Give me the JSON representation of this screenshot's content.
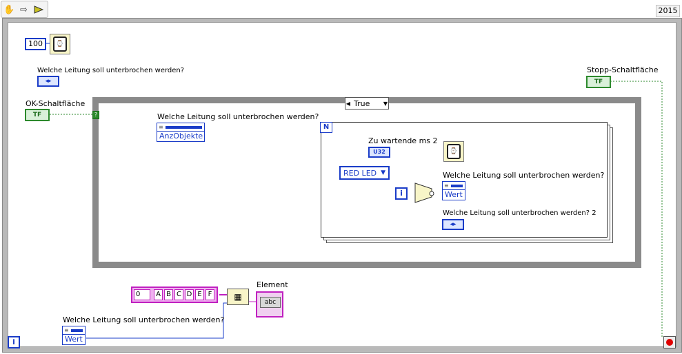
{
  "toolbar": {
    "run_mode_icon": "hand-icon",
    "arrow_icon": "arrow-right-icon",
    "run_icon": "run-arrow-icon"
  },
  "version": "2015",
  "block": {
    "wait_const": "100",
    "label_top_enum": "Welche Leitung soll unterbrochen werden?",
    "label_ok": "OK-Schaltfläche",
    "ok_term": "TF",
    "label_stop": "Stopp-Schaltfläche",
    "stop_term": "TF",
    "case_selector": "True",
    "prop_node_label": "Welche Leitung soll unterbrochen werden?",
    "prop_node_prop": "AnzObjekte",
    "n_term": "N",
    "label_wait_ms": "Zu wartende ms 2",
    "u32": "U32",
    "enum_const": "RED LED",
    "i_term": "i",
    "prop_node2_label": "Welche Leitung soll unterbrochen werden?",
    "prop_node2_prop": "Wert",
    "label_enum2": "Welche Leitung soll unterbrochen werden? 2",
    "array_index": "0",
    "array_values": [
      "A",
      "B",
      "C",
      "D",
      "E",
      "F"
    ],
    "label_element": "Element",
    "element_abc": "abc",
    "prop_node3_label": "Welche Leitung soll unterbrochen werden?",
    "prop_node3_prop": "Wert",
    "loop_i": "i"
  }
}
